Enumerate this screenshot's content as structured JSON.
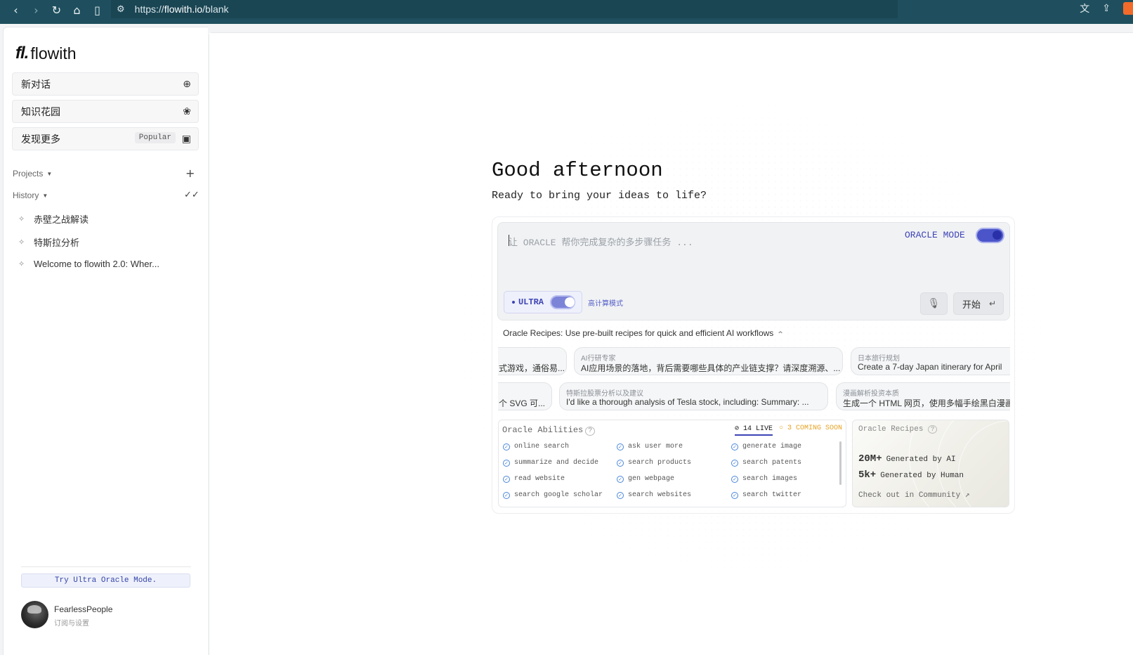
{
  "browser": {
    "url_prefix": "https://",
    "url_domain": "flowith.io",
    "url_path": "/blank",
    "icons": [
      "back-icon",
      "forward-icon",
      "reload-icon",
      "home-icon",
      "bookmark-icon",
      "site-settings-icon",
      "translate-icon",
      "share-icon",
      "brave-shield-icon"
    ]
  },
  "sidebar": {
    "logo_mark": "fl.",
    "logo_text": "flowith",
    "new_chat": "新对话",
    "knowledge_garden": "知识花园",
    "discover": "发现更多",
    "discover_tag": "Popular",
    "projects_label": "Projects",
    "history_label": "History",
    "history": [
      "赤壁之战解读",
      "特斯拉分析",
      "Welcome to flowith 2.0: Wher..."
    ],
    "try_ultra": "Try Ultra Oracle Mode.",
    "user_name": "FearlessPeople",
    "user_sub": "订阅与设置"
  },
  "main": {
    "greeting": "Good afternoon",
    "subtitle": "Ready to bring your ideas to life?",
    "input_placeholder": "让 ORACLE 帮你完成复杂的多步骤任务 ...",
    "oracle_mode_label": "ORACLE MODE",
    "oracle_mode_on": true,
    "ultra_label": "ULTRA",
    "ultra_on": true,
    "high_compute": "高计算模式",
    "start_label": "开始",
    "recipes_title": "Oracle Recipes: Use pre-built recipes for quick and efficient AI workflows",
    "recipes_row1": [
      {
        "title": "",
        "body": "式游戏，通俗易..."
      },
      {
        "title": "AI行研专家",
        "body": "AI应用场景的落地，背后需要哪些具体的产业链支撑？请深度溯源、..."
      },
      {
        "title": "日本旅行规划",
        "body": "Create a 7-day Japan itinerary for April"
      }
    ],
    "recipes_row2": [
      {
        "title": "",
        "body": "个 SVG 可..."
      },
      {
        "title": "特斯拉股票分析以及建议",
        "body": "I'd like a thorough analysis of Tesla stock, including: Summary: ..."
      },
      {
        "title": "漫画解析投资本质",
        "body": "生成一个 HTML 网页，使用多幅手绘黑白漫画"
      }
    ],
    "abilities_title": "Oracle Abilities",
    "live_label": "14 LIVE",
    "soon_label": "3 COMING SOON",
    "abilities": [
      [
        "online search",
        "ask user more",
        "generate image"
      ],
      [
        "summarize and decide",
        "search products",
        "search patents"
      ],
      [
        "read website",
        "gen webpage",
        "search images"
      ],
      [
        "search google scholar",
        "search websites",
        "search twitter"
      ]
    ],
    "stats_title": "Oracle Recipes",
    "stat1_big": "20M+",
    "stat1_small": "Generated by AI",
    "stat2_big": "5k+",
    "stat2_small": "Generated by Human",
    "community": "Check out in Community ↗"
  }
}
